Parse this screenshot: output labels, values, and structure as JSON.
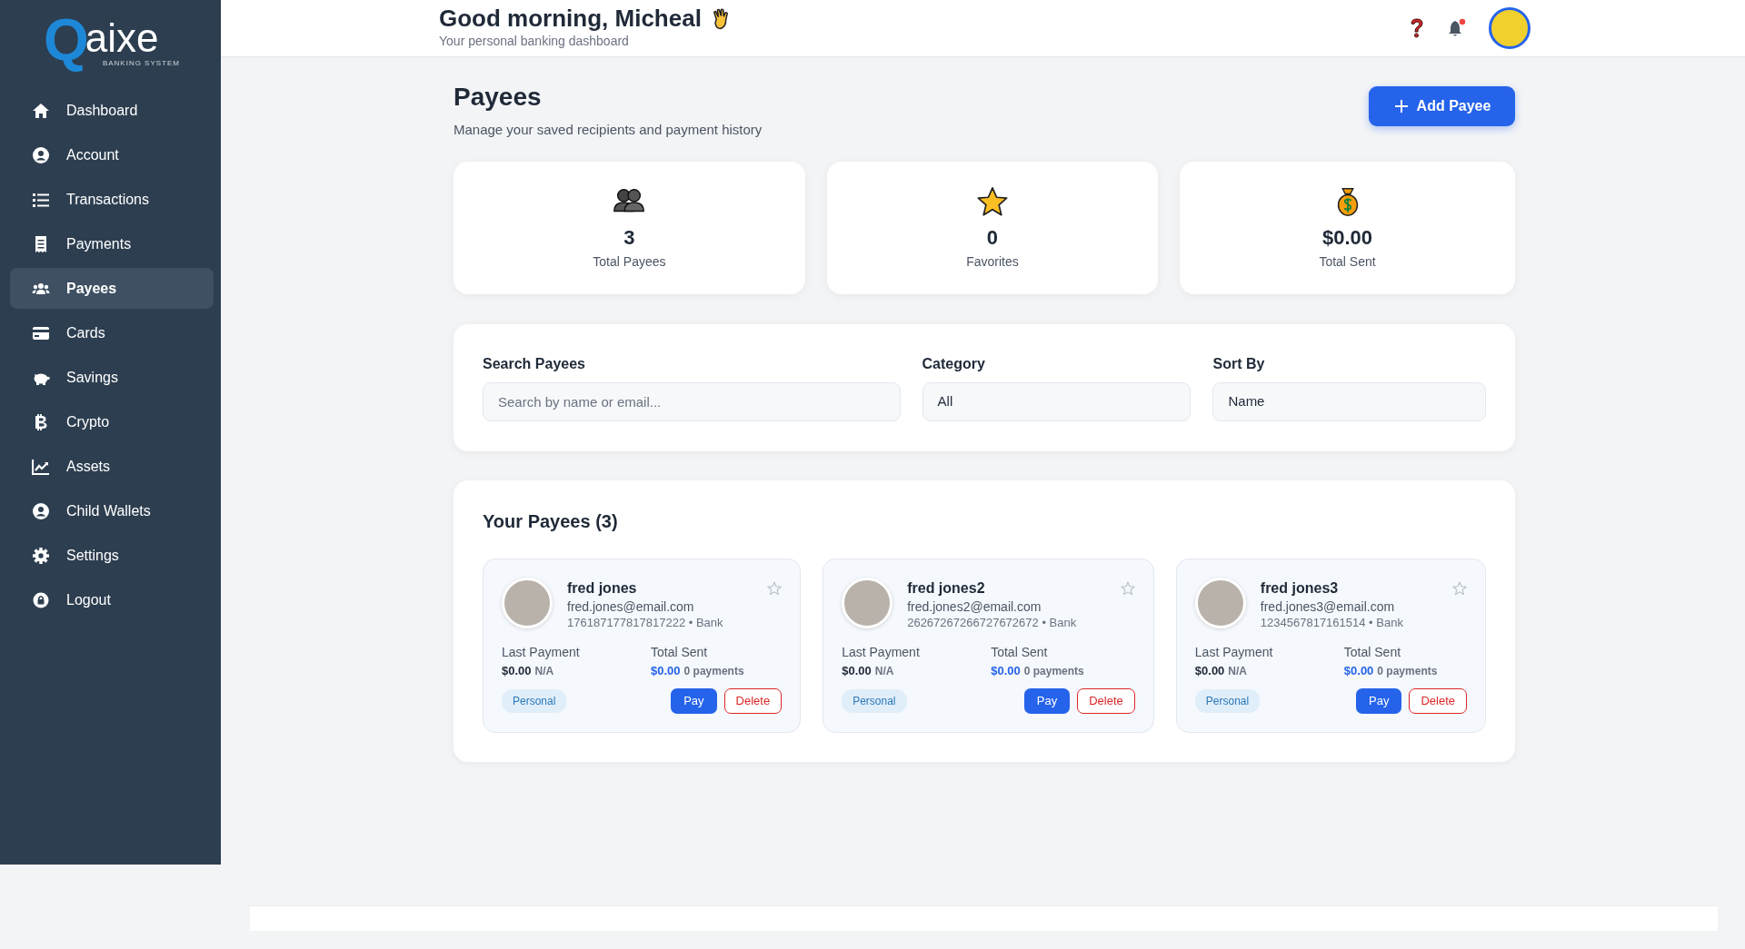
{
  "logo": {
    "mark": "Q",
    "name": "aixe",
    "tagline": "BANKING SYSTEM"
  },
  "sidebar": {
    "items": [
      {
        "label": "Dashboard",
        "selected": false
      },
      {
        "label": "Account",
        "selected": false
      },
      {
        "label": "Transactions",
        "selected": false
      },
      {
        "label": "Payments",
        "selected": false
      },
      {
        "label": "Payees",
        "selected": true
      },
      {
        "label": "Cards",
        "selected": false
      },
      {
        "label": "Savings",
        "selected": false
      },
      {
        "label": "Crypto",
        "selected": false
      },
      {
        "label": "Assets",
        "selected": false
      },
      {
        "label": "Child Wallets",
        "selected": false
      },
      {
        "label": "Settings",
        "selected": false
      },
      {
        "label": "Logout",
        "selected": false
      }
    ]
  },
  "header": {
    "greeting": "Good morning, Micheal",
    "subtitle": "Your personal banking dashboard",
    "has_notifications": true
  },
  "page": {
    "title": "Payees",
    "subtitle": "Manage your saved recipients and payment history",
    "add_button": "Add Payee"
  },
  "stats": [
    {
      "kind": "payees",
      "value": "3",
      "label": "Total Payees"
    },
    {
      "kind": "favorites",
      "value": "0",
      "label": "Favorites"
    },
    {
      "kind": "sent",
      "value": "$0.00",
      "label": "Total Sent"
    }
  ],
  "filters": [
    {
      "kind": "text",
      "label": "Search Payees",
      "placeholder": "Search by name or email..."
    },
    {
      "kind": "select",
      "label": "Category",
      "value": "All"
    },
    {
      "kind": "select",
      "label": "Sort By",
      "value": "Name"
    }
  ],
  "payees_section": {
    "title": "Your Payees (3)",
    "payees": [
      {
        "name": "fred jones",
        "email": "fred.jones@email.com",
        "account": "176187177817817222 • Bank",
        "favorite": false,
        "last_payment_label": "Last Payment",
        "last_payment_amount": "$0.00",
        "last_payment_date": "N/A",
        "total_sent_label": "Total Sent",
        "total_sent_amount": "$0.00",
        "payment_count": "0 payments",
        "category": "Personal",
        "pay_button": "Pay",
        "delete_button": "Delete"
      },
      {
        "name": "fred jones2",
        "email": "fred.jones2@email.com",
        "account": "26267267266727672672 • Bank",
        "favorite": false,
        "last_payment_label": "Last Payment",
        "last_payment_amount": "$0.00",
        "last_payment_date": "N/A",
        "total_sent_label": "Total Sent",
        "total_sent_amount": "$0.00",
        "payment_count": "0 payments",
        "category": "Personal",
        "pay_button": "Pay",
        "delete_button": "Delete"
      },
      {
        "name": "fred jones3",
        "email": "fred.jones3@email.com",
        "account": "1234567817161514 • Bank",
        "favorite": false,
        "last_payment_label": "Last Payment",
        "last_payment_amount": "$0.00",
        "last_payment_date": "N/A",
        "total_sent_label": "Total Sent",
        "total_sent_amount": "$0.00",
        "payment_count": "0 payments",
        "category": "Personal",
        "pay_button": "Pay",
        "delete_button": "Delete"
      }
    ]
  }
}
